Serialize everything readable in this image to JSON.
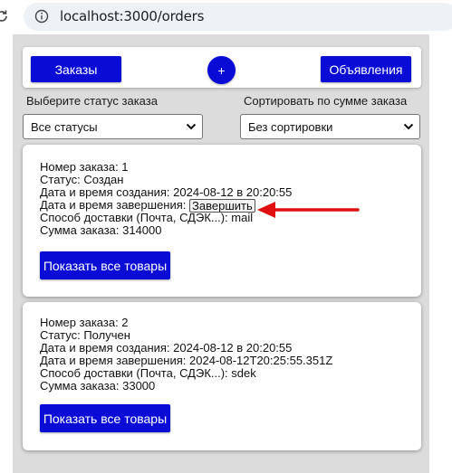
{
  "browser": {
    "url": "localhost:3000/orders",
    "reload_icon": "reload-icon",
    "info_icon": "info-icon"
  },
  "nav": {
    "orders_label": "Заказы",
    "add_label": "+",
    "ads_label": "Объявления",
    "accent": "#0b0bd6"
  },
  "filters": {
    "status_label": "Выберите статус заказа",
    "status_value": "Все статусы",
    "sort_label": "Сортировать по сумме заказа",
    "sort_value": "Без сортировки"
  },
  "orders": [
    {
      "number": "Номер заказа: 1",
      "status": "Статус: Создан",
      "created": "Дата и время создания: 2024-08-12 в 20:20:55",
      "finished_prefix": "Дата и время завершения:",
      "finish_button": "Завершить",
      "delivery": "Способ доставки (Почта, СДЭК...): mail",
      "total": "Сумма заказа: 314000",
      "show_button": "Показать все товары"
    },
    {
      "number": "Номер заказа: 2",
      "status": "Статус: Получен",
      "created": "Дата и время создания: 2024-08-12 в 20:20:55",
      "finished": "Дата и время завершения: 2024-08-12T20:25:55.351Z",
      "delivery": "Способ доставки (Почта, СДЭК...): sdek",
      "total": "Сумма заказа: 33000",
      "show_button": "Показать все товары"
    }
  ],
  "annotation": {
    "arrow_color": "#e01010"
  }
}
